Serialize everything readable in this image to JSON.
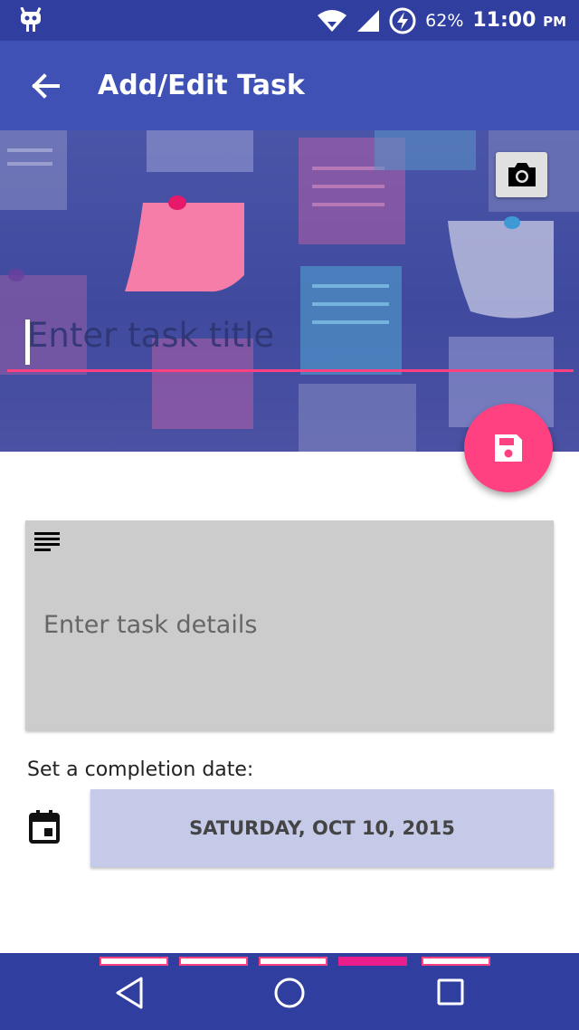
{
  "status_bar": {
    "battery": "62%",
    "time": "11:00",
    "time_suffix": "PM",
    "icons": [
      "android-notification-icon",
      "wifi-icon",
      "signal-icon",
      "battery-charging-icon"
    ]
  },
  "toolbar": {
    "title": "Add/Edit Task",
    "back_icon": "arrow-back-icon"
  },
  "hero": {
    "camera_icon": "camera-icon"
  },
  "title_input": {
    "placeholder": "Enter task title",
    "value": ""
  },
  "fab": {
    "icon": "save-icon",
    "color": "#ff4081"
  },
  "details": {
    "placeholder": "Enter task details",
    "icon": "notes-icon"
  },
  "date": {
    "label": "Set a completion date:",
    "value": "SATURDAY, OCT 10, 2015",
    "icon": "calendar-icon"
  },
  "nav_bar": {
    "page_indicators": 5,
    "active_indicator": 4,
    "buttons": [
      "back-icon",
      "home-icon",
      "recents-icon"
    ]
  },
  "colors": {
    "primary": "#3f51b5",
    "primary_dark": "#303f9f",
    "accent": "#ff4081",
    "date_button": "#c5cae9",
    "details_card": "#cccccc"
  }
}
